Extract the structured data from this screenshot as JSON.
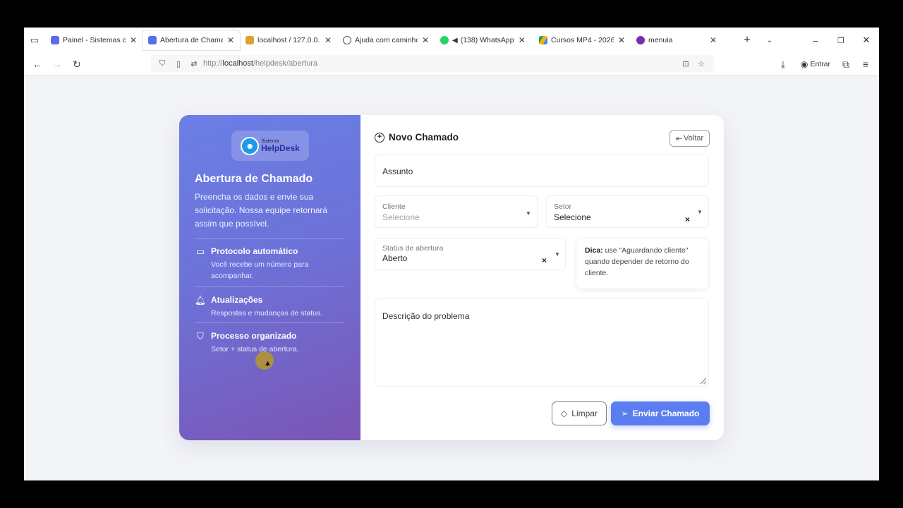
{
  "browser": {
    "tabs": [
      {
        "title": "Painel - Sistemas com",
        "active": false,
        "favicon_color": "#5b6de6"
      },
      {
        "title": "Abertura de Chamado",
        "active": true,
        "favicon_color": "#5b6de6"
      },
      {
        "title": "localhost / 127.0.0.1 /",
        "active": false,
        "favicon_color": "#e0a030"
      },
      {
        "title": "Ajuda com caminho fo",
        "active": false,
        "favicon_color": "#555555"
      },
      {
        "title": "(138) WhatsApp B",
        "active": false,
        "favicon_color": "#25d366"
      },
      {
        "title": "Cursos MP4 - 2026 - C",
        "active": false,
        "favicon_color": "#f4b400"
      },
      {
        "title": "menuia",
        "active": false,
        "favicon_color": "#7a2ea8"
      }
    ],
    "url_prefix": "http://",
    "url_host": "localhost",
    "url_path": "/helpdesk/abertura",
    "signin_label": "Entrar"
  },
  "sidebar": {
    "logo_small": "Sistema",
    "logo_big": "HelpDesk",
    "title": "Abertura de Chamado",
    "subtitle": "Preencha os dados e envie sua solicitação. Nossa equipe retornará assim que possível.",
    "features": [
      {
        "title": "Protocolo automático",
        "desc": "Você recebe um número para acompanhar.",
        "icon": "ticket-icon"
      },
      {
        "title": "Atualizações",
        "desc": "Respostas e mudanças de status.",
        "icon": "bell-icon"
      },
      {
        "title": "Processo organizado",
        "desc": "Setor + status de abertura.",
        "icon": "shield-icon"
      }
    ]
  },
  "form": {
    "title": "Novo Chamado",
    "back_label": "Voltar",
    "subject_placeholder": "Assunto",
    "client": {
      "label": "Cliente",
      "value": "Selecione"
    },
    "sector": {
      "label": "Setor",
      "value": "Selecione"
    },
    "status": {
      "label": "Status de abertura",
      "value": "Aberto"
    },
    "tip_bold": "Dica:",
    "tip_text": " use \"Aguardando cliente\" quando depender de retorno do cliente.",
    "description_placeholder": "Descrição do problema",
    "clear_label": "Limpar",
    "submit_label": "Enviar Chamado",
    "accent": "#5b7df0"
  }
}
